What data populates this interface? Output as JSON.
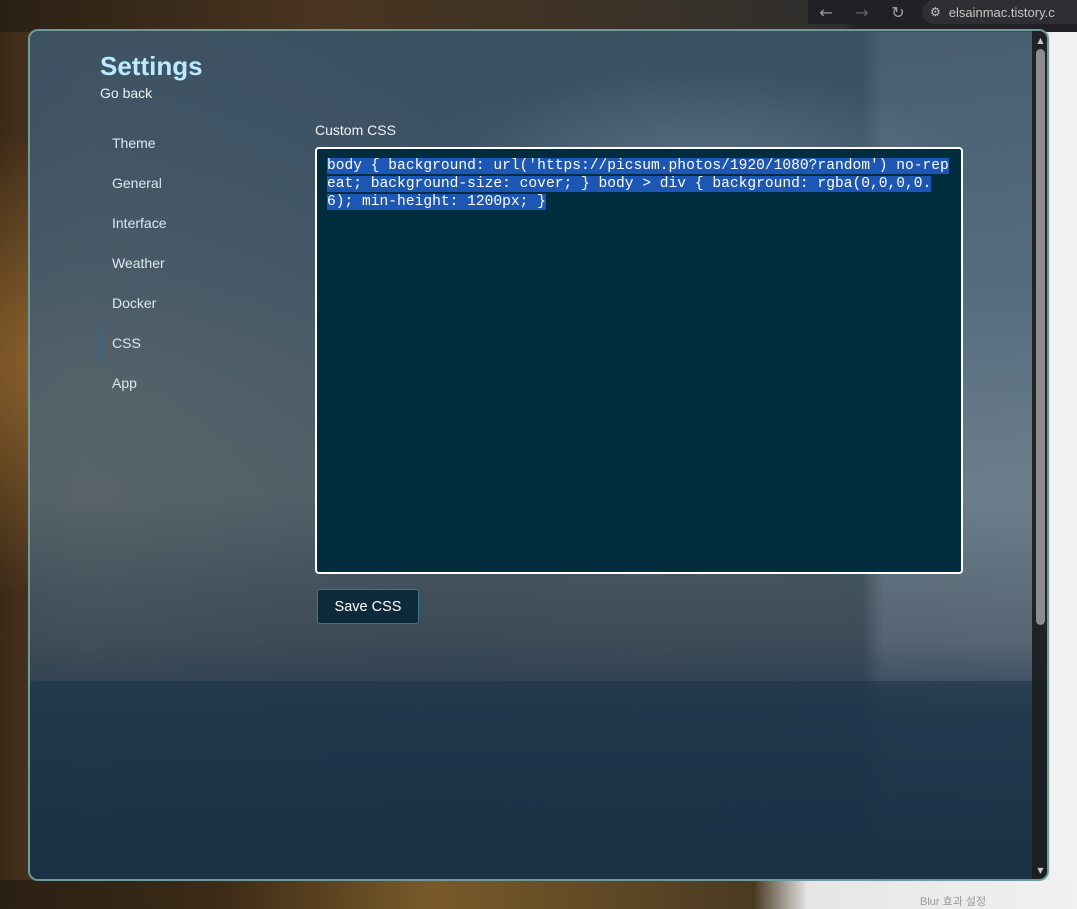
{
  "browser": {
    "back_icon": "←",
    "forward_icon": "→",
    "reload_icon": "↻",
    "site_info_icon": "⚙",
    "url": "elsainmac.tistory.c"
  },
  "background": {
    "footer_text": "Blur 효과 설정"
  },
  "settings": {
    "title": "Settings",
    "go_back": "Go back",
    "sidebar": {
      "items": [
        {
          "label": "Theme"
        },
        {
          "label": "General"
        },
        {
          "label": "Interface"
        },
        {
          "label": "Weather"
        },
        {
          "label": "Docker"
        },
        {
          "label": "CSS",
          "active": true
        },
        {
          "label": "App"
        }
      ]
    },
    "css_panel": {
      "label": "Custom CSS",
      "value": "body { background: url('https://picsum.photos/1920/1080?random') no-repeat; background-size: cover; } body > div { background: rgba(0,0,0,0.6); min-height: 1200px; }",
      "save_label": "Save CSS"
    }
  },
  "scrollbar": {
    "up_icon": "▲",
    "down_icon": "▼"
  },
  "colors": {
    "title": "#b7ecff",
    "editor_bg": "#022d3f",
    "selection": "#1d57b6",
    "active_indicator": "#2e6b86"
  }
}
